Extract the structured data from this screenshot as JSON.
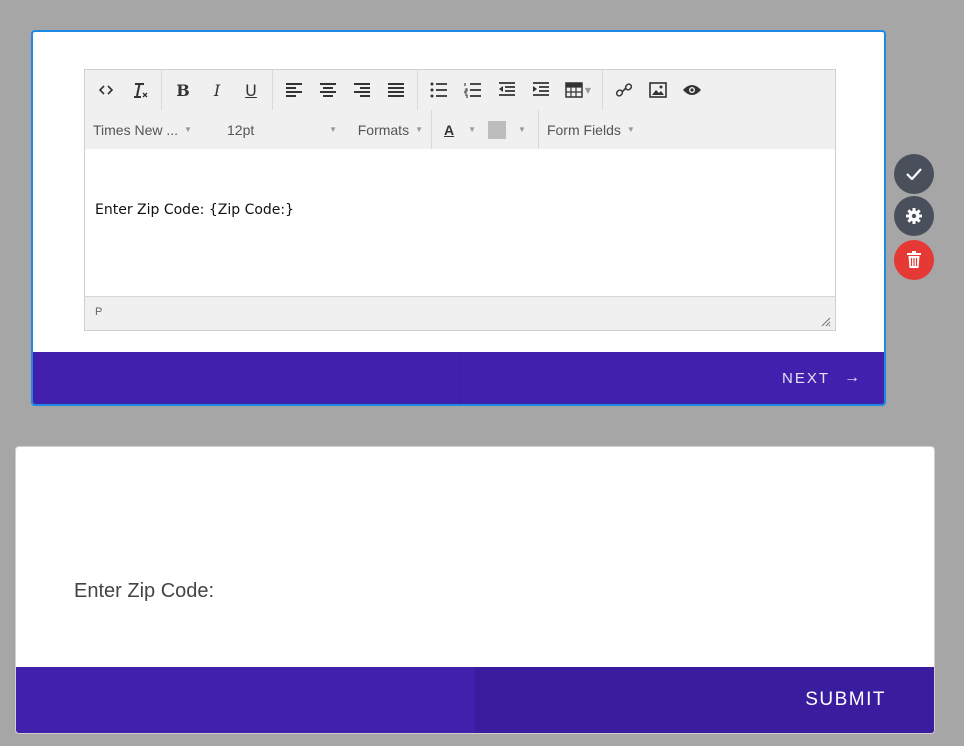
{
  "editor": {
    "toolbar_row1": [
      {
        "icon": "source-code-icon",
        "glyph": "<>"
      },
      {
        "icon": "clear-format-icon",
        "glyph": "Tx"
      },
      {
        "icon": "bold-icon",
        "glyph": "B"
      },
      {
        "icon": "italic-icon",
        "glyph": "I"
      },
      {
        "icon": "underline-icon",
        "glyph": "U"
      },
      {
        "icon": "align-left-icon"
      },
      {
        "icon": "align-center-icon"
      },
      {
        "icon": "align-right-icon"
      },
      {
        "icon": "align-justify-icon"
      },
      {
        "icon": "bullet-list-icon"
      },
      {
        "icon": "numbered-list-icon"
      },
      {
        "icon": "outdent-icon"
      },
      {
        "icon": "indent-icon"
      },
      {
        "icon": "table-icon"
      },
      {
        "icon": "link-icon"
      },
      {
        "icon": "image-icon"
      },
      {
        "icon": "preview-icon"
      }
    ],
    "font_family": "Times New ...",
    "font_size": "12pt",
    "formats_label": "Formats",
    "text_color_label": "A",
    "form_fields_label": "Form Fields",
    "content": "Enter Zip Code: {Zip Code:}",
    "status_path": "P"
  },
  "next_button": {
    "label": "NEXT",
    "arrow": "→"
  },
  "side_actions": [
    {
      "icon": "check-icon",
      "color": "#4a4f5c"
    },
    {
      "icon": "gear-icon",
      "color": "#4a4f5c"
    },
    {
      "icon": "trash-icon",
      "color": "#e53935"
    }
  ],
  "preview": {
    "label": "Enter Zip Code:",
    "submit_label": "SUBMIT"
  },
  "colors": {
    "accent": "#4120ad",
    "accent_dark": "#3a1c9e",
    "card_border": "#1e88e5"
  }
}
